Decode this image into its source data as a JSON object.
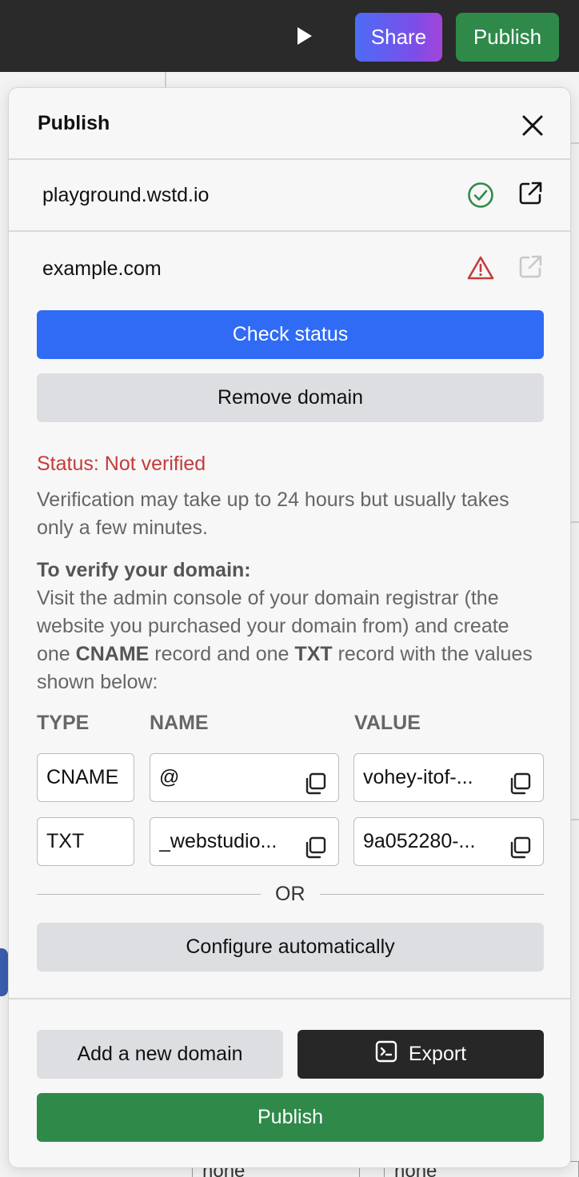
{
  "topbar": {
    "play_icon": "play-icon",
    "share_label": "Share",
    "publish_label": "Publish"
  },
  "panel": {
    "title": "Publish",
    "close_icon": "close-icon",
    "domains": [
      {
        "name": "playground.wstd.io",
        "status_icon": "check-circle-icon",
        "status_color": "#2f8a4a"
      },
      {
        "name": "example.com",
        "status_icon": "warning-icon",
        "status_color": "#c43b3b"
      }
    ],
    "check_status_label": "Check status",
    "remove_domain_label": "Remove domain",
    "status_text": "Status: Not verified",
    "verification_note": "Verification may take up to 24 hours but usually takes only a few minutes.",
    "instructions": {
      "heading": "To verify your domain:",
      "line_a": "Visit the admin console of your domain registrar (the website you purchased your domain from) and create one ",
      "cname": "CNAME",
      "line_b": " record and one ",
      "txt": "TXT",
      "line_c": " record with the values shown below:"
    },
    "records": {
      "headers": [
        "TYPE",
        "NAME",
        "VALUE"
      ],
      "rows": [
        {
          "type": "CNAME",
          "name": "@",
          "value": "vohey-itof-..."
        },
        {
          "type": "TXT",
          "name": "_webstudio...",
          "value": "9a052280-..."
        }
      ]
    },
    "or_label": "OR",
    "configure_label": "Configure automatically",
    "add_domain_label": "Add a new domain",
    "export_label": "Export",
    "publish_label": "Publish"
  },
  "background": {
    "cell_a": "none",
    "cell_b": "none"
  },
  "colors": {
    "primary": "#2f6bf5",
    "success": "#2f8a4a",
    "danger": "#c43b3b",
    "dark": "#272727"
  }
}
